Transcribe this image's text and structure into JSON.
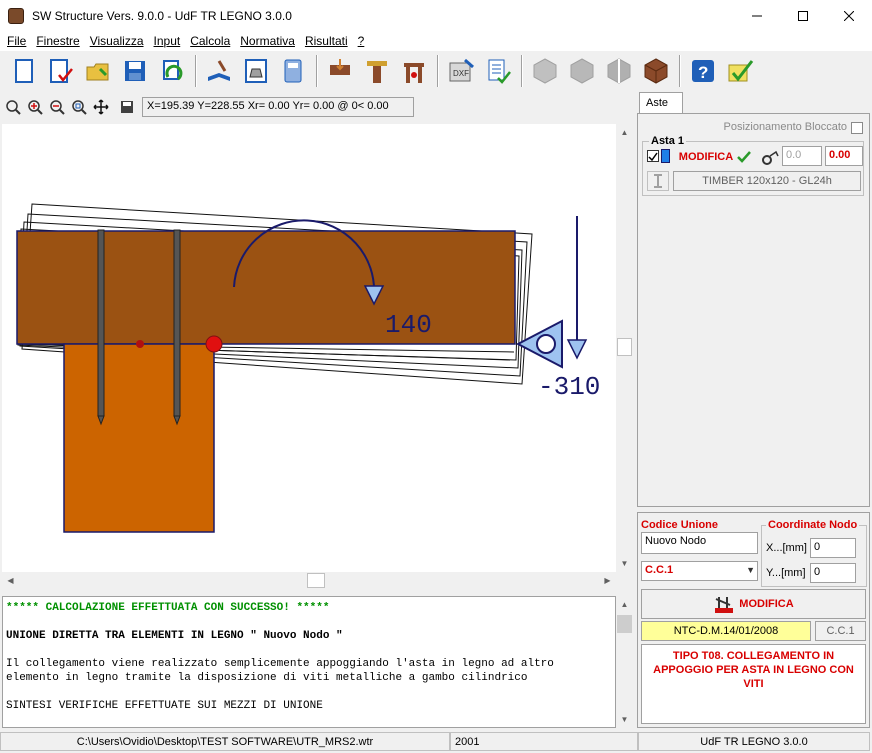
{
  "window": {
    "title": "SW Structure Vers. 9.0.0 - UdF TR LEGNO 3.0.0",
    "minimize_icon": "minimize-icon",
    "maximize_icon": "maximize-icon",
    "close_icon": "close-icon"
  },
  "menu": [
    "File",
    "Finestre",
    "Visualizza",
    "Input",
    "Calcola",
    "Normativa",
    "Risultati",
    "?"
  ],
  "toolbar": {
    "icons": [
      "new-document-icon",
      "check-document-icon",
      "open-folder-icon",
      "save-icon",
      "refresh-icon",
      "book-icon",
      "weight-icon",
      "calculator-icon",
      "beam-load-icon",
      "column-load-icon",
      "frame-load-icon",
      "dxf-export-icon",
      "report-icon",
      "hexagon-icon",
      "hexagon-icon",
      "section-icon",
      "timber-cube-icon",
      "help-icon",
      "verify-icon"
    ],
    "colors": {
      "blue": "#1f5fb8",
      "green": "#2a9a2a",
      "orange": "#d08030",
      "gray": "#a0a0a0",
      "brown": "#8b4a2a"
    }
  },
  "drawbar": {
    "icons": [
      "zoom-extent-icon",
      "zoom-in-icon",
      "zoom-out-icon",
      "zoom-window-icon",
      "pan-icon",
      "export-dxf-icon"
    ],
    "coords": "X=195.39 Y=228.55 Xr= 0.00 Yr= 0.00 @  0< 0.00"
  },
  "canvas": {
    "moment_label": "140",
    "force_label": "-310",
    "colors": {
      "beam": "#9b5212",
      "column": "#cc6400",
      "outline": "#1a1a6a",
      "support": "#9ec3f0",
      "node": "#e01010"
    }
  },
  "output": {
    "lines": [
      {
        "text": "***** CALCOLAZIONE EFFETTUATA CON SUCCESSO! *****",
        "color": "#009000",
        "bold": true
      },
      {
        "text": "",
        "color": "#000",
        "bold": false
      },
      {
        "text": "UNIONE DIRETTA TRA ELEMENTI IN LEGNO \" Nuovo Nodo \"",
        "color": "#000",
        "bold": true
      },
      {
        "text": "",
        "color": "#000",
        "bold": false
      },
      {
        "text": "Il collegamento viene realizzato semplicemente appoggiando l'asta in legno ad altro",
        "color": "#000",
        "bold": false
      },
      {
        "text": "elemento in legno tramite la disposizione di viti metalliche a gambo cilindrico",
        "color": "#000",
        "bold": false
      },
      {
        "text": "",
        "color": "#000",
        "bold": false
      },
      {
        "text": "SINTESI VERIFICHE EFFETTUATE SUI MEZZI DI UNIONE",
        "color": "#000",
        "bold": false
      }
    ]
  },
  "panel": {
    "tab": "Aste",
    "lock_label": "Posizionamento Bloccato",
    "asta_title": "Asta 1",
    "modifica": "MODIFICA",
    "angle_value": "0.0",
    "offset_value": "0.00",
    "section": "TIMBER 120x120 - GL24h",
    "codice_label": "Codice Unione",
    "codice_value": "Nuovo Nodo",
    "coord_label": "Coordinate Nodo",
    "x_label": "X...[mm]",
    "x_value": "0",
    "y_label": "Y...[mm]",
    "y_value": "0",
    "cc_select": "C.C.1",
    "modifica2": "MODIFICA",
    "norm_label": "NTC-D.M.14/01/2008",
    "cc_label": "C.C.1",
    "desc": "TIPO T08. COLLEGAMENTO IN APPOGGIO PER ASTA IN LEGNO CON VITI"
  },
  "status": {
    "path": "C:\\Users\\Ovidio\\Desktop\\TEST SOFTWARE\\UTR_MRS2.wtr",
    "code": "2001",
    "module": "UdF TR LEGNO 3.0.0"
  }
}
